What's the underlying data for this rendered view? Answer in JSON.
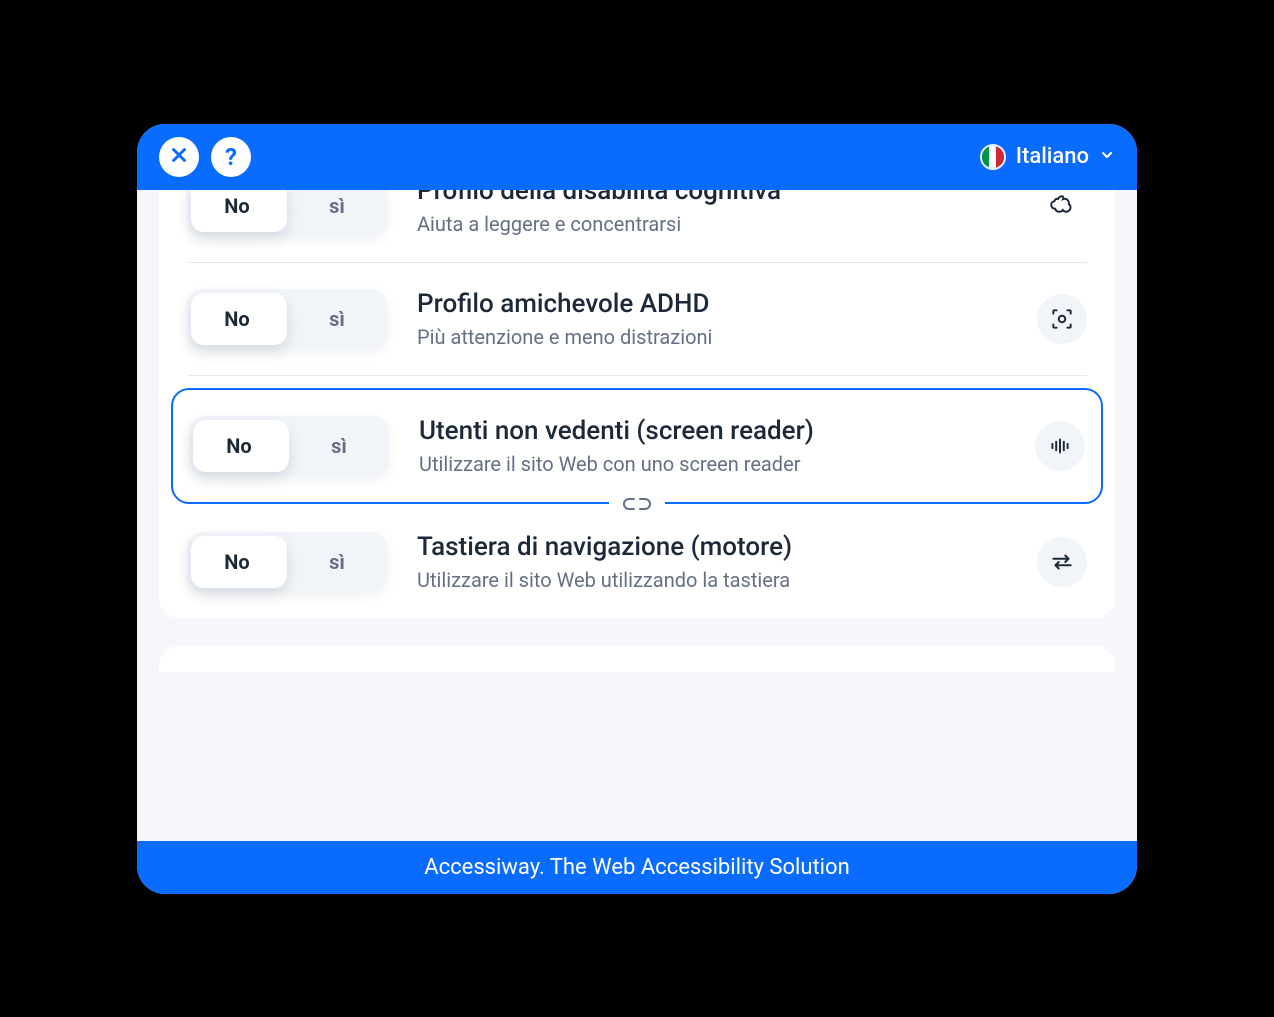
{
  "header": {
    "language_label": "Italiano"
  },
  "toggle_labels": {
    "no": "No",
    "yes": "sì"
  },
  "profiles": [
    {
      "title": "Profilo della disabilità cognitiva",
      "subtitle": "Aiuta a leggere e concentrarsi",
      "icon": "cloud",
      "highlighted": false
    },
    {
      "title": "Profilo amichevole ADHD",
      "subtitle": "Più attenzione e meno distrazioni",
      "icon": "focus",
      "highlighted": false
    },
    {
      "title": "Utenti non vedenti (screen reader)",
      "subtitle": "Utilizzare il sito Web con uno screen reader",
      "icon": "sound",
      "highlighted": true
    },
    {
      "title": "Tastiera di navigazione (motore)",
      "subtitle": "Utilizzare il sito Web utilizzando la tastiera",
      "icon": "swap",
      "highlighted": false
    }
  ],
  "footer": {
    "tagline": "Accessiway. The Web Accessibility Solution"
  }
}
